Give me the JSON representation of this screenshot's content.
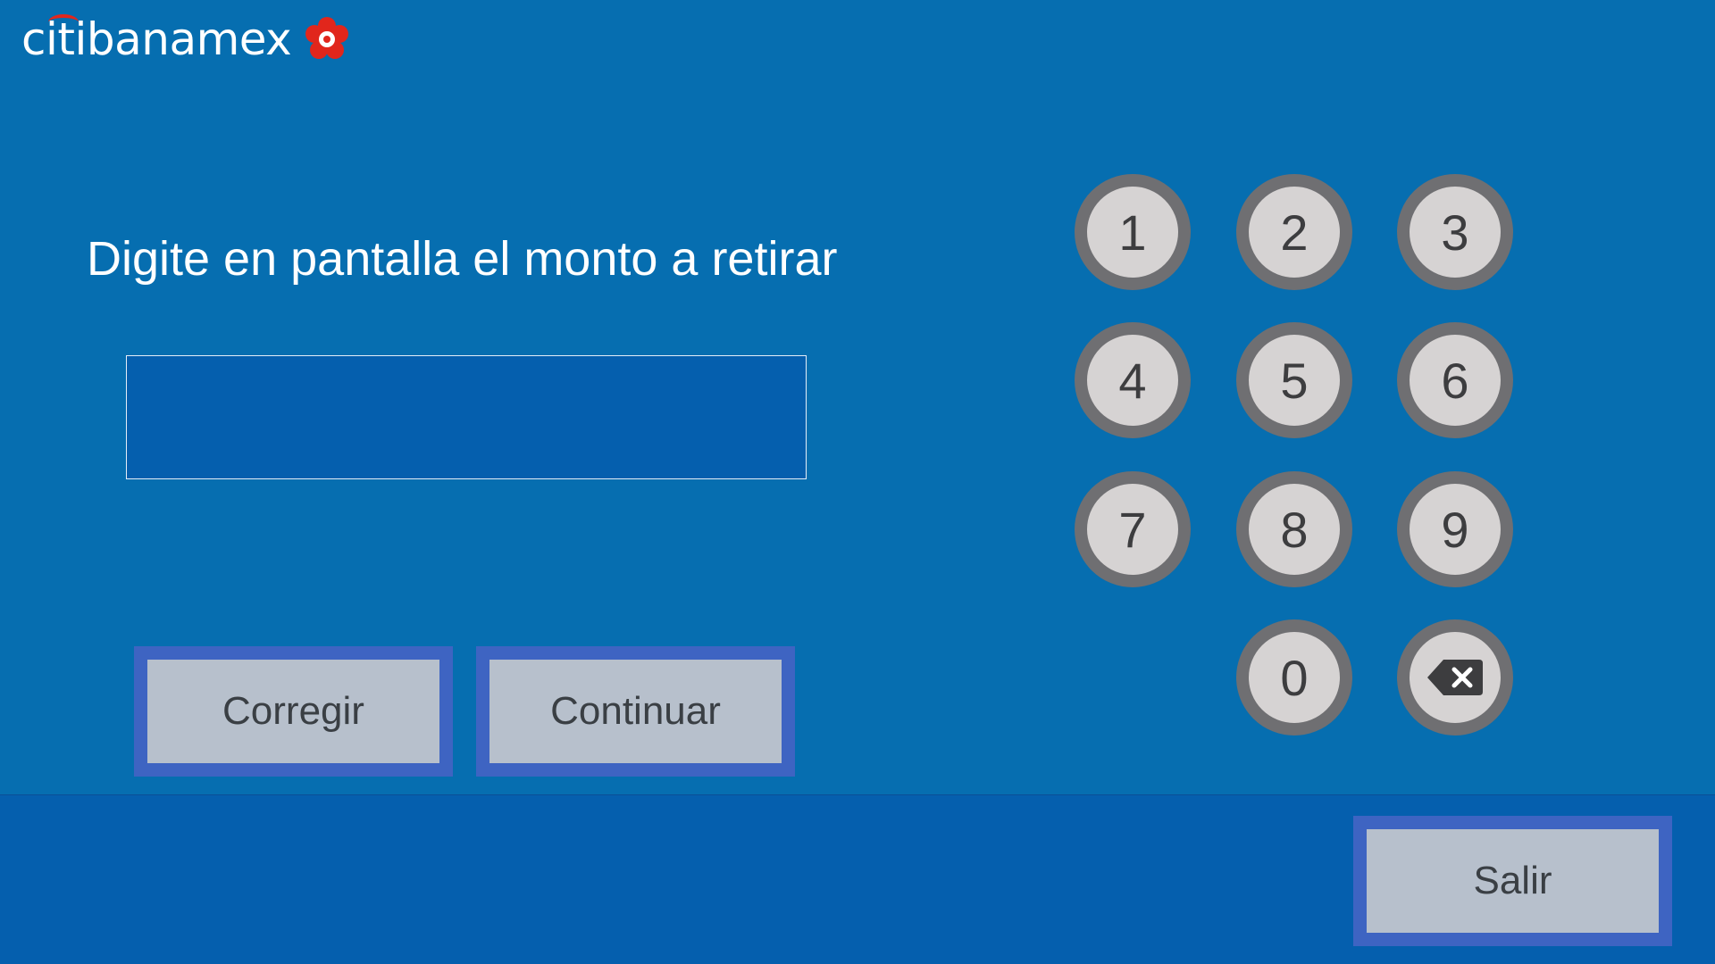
{
  "brand": {
    "name": "citibanamex",
    "accent_color": "#e1261c",
    "mark_icon": "banamex-flower-icon"
  },
  "prompt": "Digite en pantalla el monto a retirar",
  "amount_field": {
    "value": ""
  },
  "buttons": {
    "corregir": "Corregir",
    "continuar": "Continuar",
    "salir": "Salir"
  },
  "keypad": {
    "keys": [
      "1",
      "2",
      "3",
      "4",
      "5",
      "6",
      "7",
      "8",
      "9",
      "0"
    ],
    "backspace_icon": "backspace-icon"
  },
  "colors": {
    "background": "#066eb0",
    "field_background": "#055fae",
    "button_border": "#3e64c2",
    "button_fill": "#b7c0cc",
    "key_fill": "#d6d3d3",
    "key_ring": "#6f6f72"
  }
}
